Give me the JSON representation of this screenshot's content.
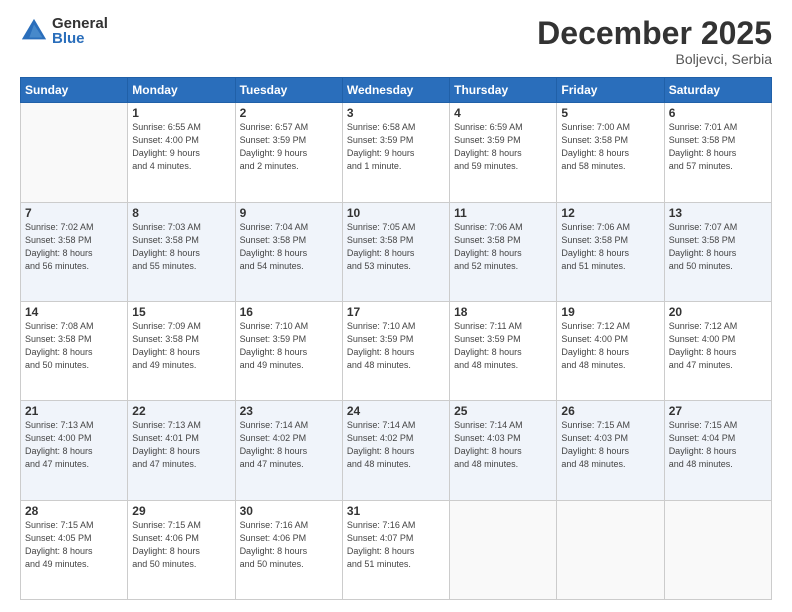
{
  "logo": {
    "general": "General",
    "blue": "Blue"
  },
  "header": {
    "title": "December 2025",
    "subtitle": "Boljevci, Serbia"
  },
  "days_of_week": [
    "Sunday",
    "Monday",
    "Tuesday",
    "Wednesday",
    "Thursday",
    "Friday",
    "Saturday"
  ],
  "weeks": [
    [
      {
        "day": "",
        "info": ""
      },
      {
        "day": "1",
        "info": "Sunrise: 6:55 AM\nSunset: 4:00 PM\nDaylight: 9 hours\nand 4 minutes."
      },
      {
        "day": "2",
        "info": "Sunrise: 6:57 AM\nSunset: 3:59 PM\nDaylight: 9 hours\nand 2 minutes."
      },
      {
        "day": "3",
        "info": "Sunrise: 6:58 AM\nSunset: 3:59 PM\nDaylight: 9 hours\nand 1 minute."
      },
      {
        "day": "4",
        "info": "Sunrise: 6:59 AM\nSunset: 3:59 PM\nDaylight: 8 hours\nand 59 minutes."
      },
      {
        "day": "5",
        "info": "Sunrise: 7:00 AM\nSunset: 3:58 PM\nDaylight: 8 hours\nand 58 minutes."
      },
      {
        "day": "6",
        "info": "Sunrise: 7:01 AM\nSunset: 3:58 PM\nDaylight: 8 hours\nand 57 minutes."
      }
    ],
    [
      {
        "day": "7",
        "info": "Sunrise: 7:02 AM\nSunset: 3:58 PM\nDaylight: 8 hours\nand 56 minutes."
      },
      {
        "day": "8",
        "info": "Sunrise: 7:03 AM\nSunset: 3:58 PM\nDaylight: 8 hours\nand 55 minutes."
      },
      {
        "day": "9",
        "info": "Sunrise: 7:04 AM\nSunset: 3:58 PM\nDaylight: 8 hours\nand 54 minutes."
      },
      {
        "day": "10",
        "info": "Sunrise: 7:05 AM\nSunset: 3:58 PM\nDaylight: 8 hours\nand 53 minutes."
      },
      {
        "day": "11",
        "info": "Sunrise: 7:06 AM\nSunset: 3:58 PM\nDaylight: 8 hours\nand 52 minutes."
      },
      {
        "day": "12",
        "info": "Sunrise: 7:06 AM\nSunset: 3:58 PM\nDaylight: 8 hours\nand 51 minutes."
      },
      {
        "day": "13",
        "info": "Sunrise: 7:07 AM\nSunset: 3:58 PM\nDaylight: 8 hours\nand 50 minutes."
      }
    ],
    [
      {
        "day": "14",
        "info": "Sunrise: 7:08 AM\nSunset: 3:58 PM\nDaylight: 8 hours\nand 50 minutes."
      },
      {
        "day": "15",
        "info": "Sunrise: 7:09 AM\nSunset: 3:58 PM\nDaylight: 8 hours\nand 49 minutes."
      },
      {
        "day": "16",
        "info": "Sunrise: 7:10 AM\nSunset: 3:59 PM\nDaylight: 8 hours\nand 49 minutes."
      },
      {
        "day": "17",
        "info": "Sunrise: 7:10 AM\nSunset: 3:59 PM\nDaylight: 8 hours\nand 48 minutes."
      },
      {
        "day": "18",
        "info": "Sunrise: 7:11 AM\nSunset: 3:59 PM\nDaylight: 8 hours\nand 48 minutes."
      },
      {
        "day": "19",
        "info": "Sunrise: 7:12 AM\nSunset: 4:00 PM\nDaylight: 8 hours\nand 48 minutes."
      },
      {
        "day": "20",
        "info": "Sunrise: 7:12 AM\nSunset: 4:00 PM\nDaylight: 8 hours\nand 47 minutes."
      }
    ],
    [
      {
        "day": "21",
        "info": "Sunrise: 7:13 AM\nSunset: 4:00 PM\nDaylight: 8 hours\nand 47 minutes."
      },
      {
        "day": "22",
        "info": "Sunrise: 7:13 AM\nSunset: 4:01 PM\nDaylight: 8 hours\nand 47 minutes."
      },
      {
        "day": "23",
        "info": "Sunrise: 7:14 AM\nSunset: 4:02 PM\nDaylight: 8 hours\nand 47 minutes."
      },
      {
        "day": "24",
        "info": "Sunrise: 7:14 AM\nSunset: 4:02 PM\nDaylight: 8 hours\nand 48 minutes."
      },
      {
        "day": "25",
        "info": "Sunrise: 7:14 AM\nSunset: 4:03 PM\nDaylight: 8 hours\nand 48 minutes."
      },
      {
        "day": "26",
        "info": "Sunrise: 7:15 AM\nSunset: 4:03 PM\nDaylight: 8 hours\nand 48 minutes."
      },
      {
        "day": "27",
        "info": "Sunrise: 7:15 AM\nSunset: 4:04 PM\nDaylight: 8 hours\nand 48 minutes."
      }
    ],
    [
      {
        "day": "28",
        "info": "Sunrise: 7:15 AM\nSunset: 4:05 PM\nDaylight: 8 hours\nand 49 minutes."
      },
      {
        "day": "29",
        "info": "Sunrise: 7:15 AM\nSunset: 4:06 PM\nDaylight: 8 hours\nand 50 minutes."
      },
      {
        "day": "30",
        "info": "Sunrise: 7:16 AM\nSunset: 4:06 PM\nDaylight: 8 hours\nand 50 minutes."
      },
      {
        "day": "31",
        "info": "Sunrise: 7:16 AM\nSunset: 4:07 PM\nDaylight: 8 hours\nand 51 minutes."
      },
      {
        "day": "",
        "info": ""
      },
      {
        "day": "",
        "info": ""
      },
      {
        "day": "",
        "info": ""
      }
    ]
  ],
  "colors": {
    "header_bg": "#2a6ebb",
    "header_text": "#ffffff",
    "accent": "#2a6ebb"
  }
}
